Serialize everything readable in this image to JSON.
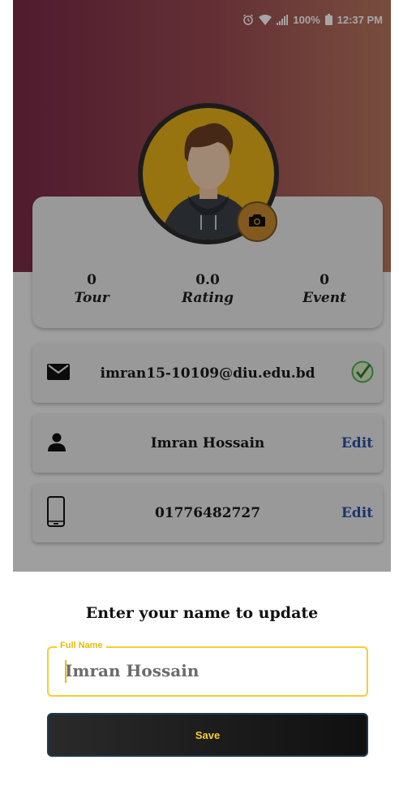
{
  "status_bar": {
    "battery": "100%",
    "time": "12:37 PM"
  },
  "profile": {
    "stats": [
      {
        "value": "0",
        "label": "Tour"
      },
      {
        "value": "0.0",
        "label": "Rating"
      },
      {
        "value": "0",
        "label": "Event"
      }
    ],
    "email": "imran15-10109@diu.edu.bd",
    "name": "Imran Hossain",
    "phone": "01776482727",
    "edit_label": "Edit"
  },
  "dialog": {
    "title": "Enter your name to update",
    "field_label": "Full Name",
    "field_value": "Imran Hossain",
    "save_label": "Save"
  },
  "colors": {
    "accent": "#f5cf2f",
    "edit_link": "#2b4fa8",
    "header_start": "#7a2a48",
    "header_end": "#b9775f",
    "verified": "#4caf50"
  },
  "icons": [
    "alarm-icon",
    "wifi-icon",
    "signal-icon",
    "battery-icon",
    "camera-icon",
    "mail-icon",
    "verified-check-icon",
    "person-icon",
    "phone-icon"
  ]
}
